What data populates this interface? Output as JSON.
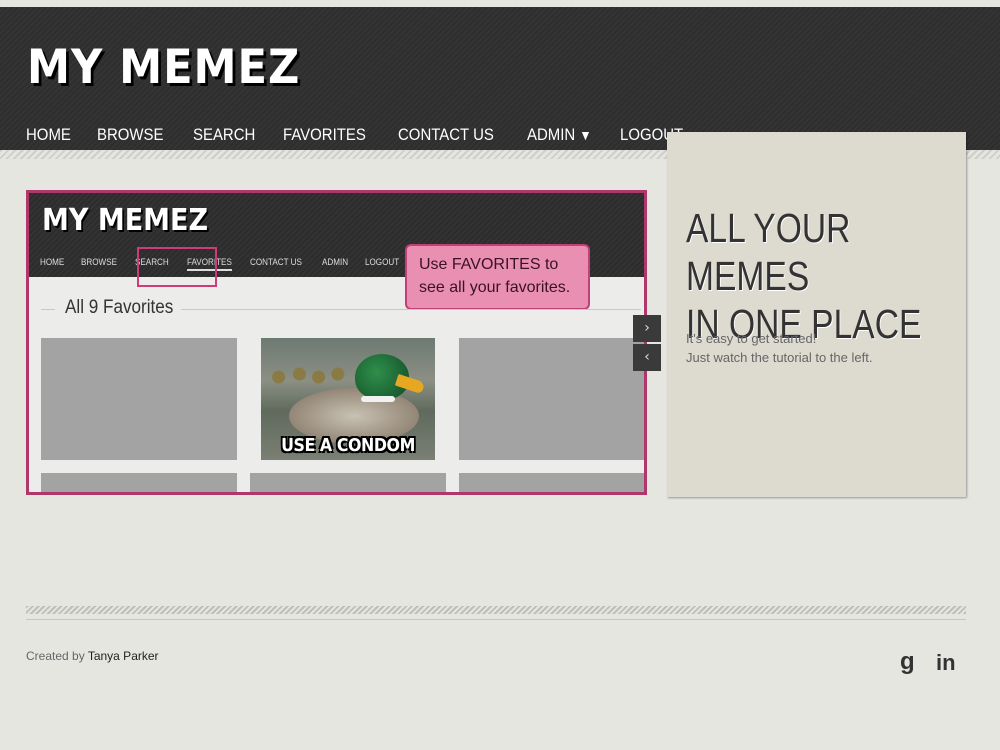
{
  "site": {
    "title": "MY MEMEZ"
  },
  "nav": {
    "items": [
      {
        "label": "HOME"
      },
      {
        "label": "BROWSE"
      },
      {
        "label": "SEARCH"
      },
      {
        "label": "FAVORITES"
      },
      {
        "label": "CONTACT US"
      },
      {
        "label": "ADMIN"
      },
      {
        "label": "LOGOUT"
      }
    ],
    "admin_caret": "▼"
  },
  "slide": {
    "mini_title": "MY MEMEZ",
    "mini_nav": [
      "HOME",
      "BROWSE",
      "SEARCH",
      "FAVORITES",
      "CONTACT US",
      "ADMIN",
      "LOGOUT"
    ],
    "callout_line1": "Use FAVORITES to",
    "callout_line2": "see all your favorites.",
    "heading": "All 9 Favorites",
    "meme_caption": "USE A CONDOM"
  },
  "controls": {
    "next": "›",
    "prev": "‹"
  },
  "promo": {
    "headline_line1": "ALL YOUR MEMES",
    "headline_line2": "IN ONE PLACE",
    "text_line1": "It's easy to get started!",
    "text_line2": "Just watch the tutorial to the left."
  },
  "footer": {
    "created_by": "Created by",
    "author": "Tanya Parker",
    "social": {
      "google": "g",
      "linkedin": "in"
    }
  }
}
